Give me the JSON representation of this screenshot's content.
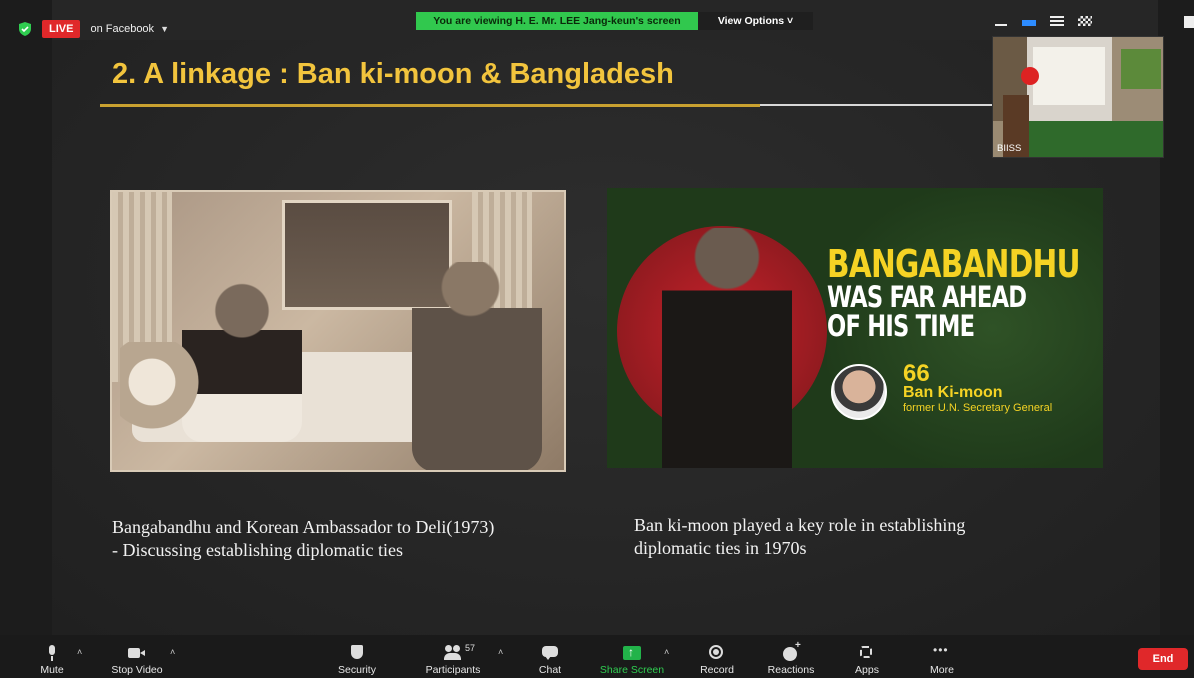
{
  "meeting": {
    "live_badge": "LIVE",
    "live_destination": "on Facebook",
    "viewing_banner": "You are viewing H. E. Mr. LEE Jang-keun's screen",
    "view_options": "View Options ˅"
  },
  "slide": {
    "title": "2. A linkage : Ban ki-moon & Bangladesh",
    "left_caption_line1": "Bangabandhu and Korean Ambassador to Deli(1973)",
    "left_caption_line2": "- Discussing establishing diplomatic ties",
    "right_caption_line1": "Ban ki-moon played a key role in establishing",
    "right_caption_line2": "diplomatic ties in 1970s",
    "poster": {
      "headline_line1": "BANGABANDHU",
      "headline_line2": "WAS FAR AHEAD",
      "headline_line3": "OF HIS TIME",
      "quote_mark": "66",
      "quote_name": "Ban Ki-moon",
      "quote_role": "former U.N. Secretary General"
    }
  },
  "participant_thumbnail": {
    "name_label": "BIISS"
  },
  "toolbar": {
    "mute": "Mute",
    "stop_video": "Stop Video",
    "security": "Security",
    "participants": "Participants",
    "participants_count": "57",
    "chat": "Chat",
    "share_screen": "Share Screen",
    "record": "Record",
    "reactions": "Reactions",
    "apps": "Apps",
    "more": "More",
    "end": "End"
  },
  "colors": {
    "slide_title": "#f2c43d",
    "live_red": "#e0282a",
    "banner_green": "#31c84e",
    "share_green": "#22b34a",
    "speaker_blue": "#2d8cff"
  }
}
